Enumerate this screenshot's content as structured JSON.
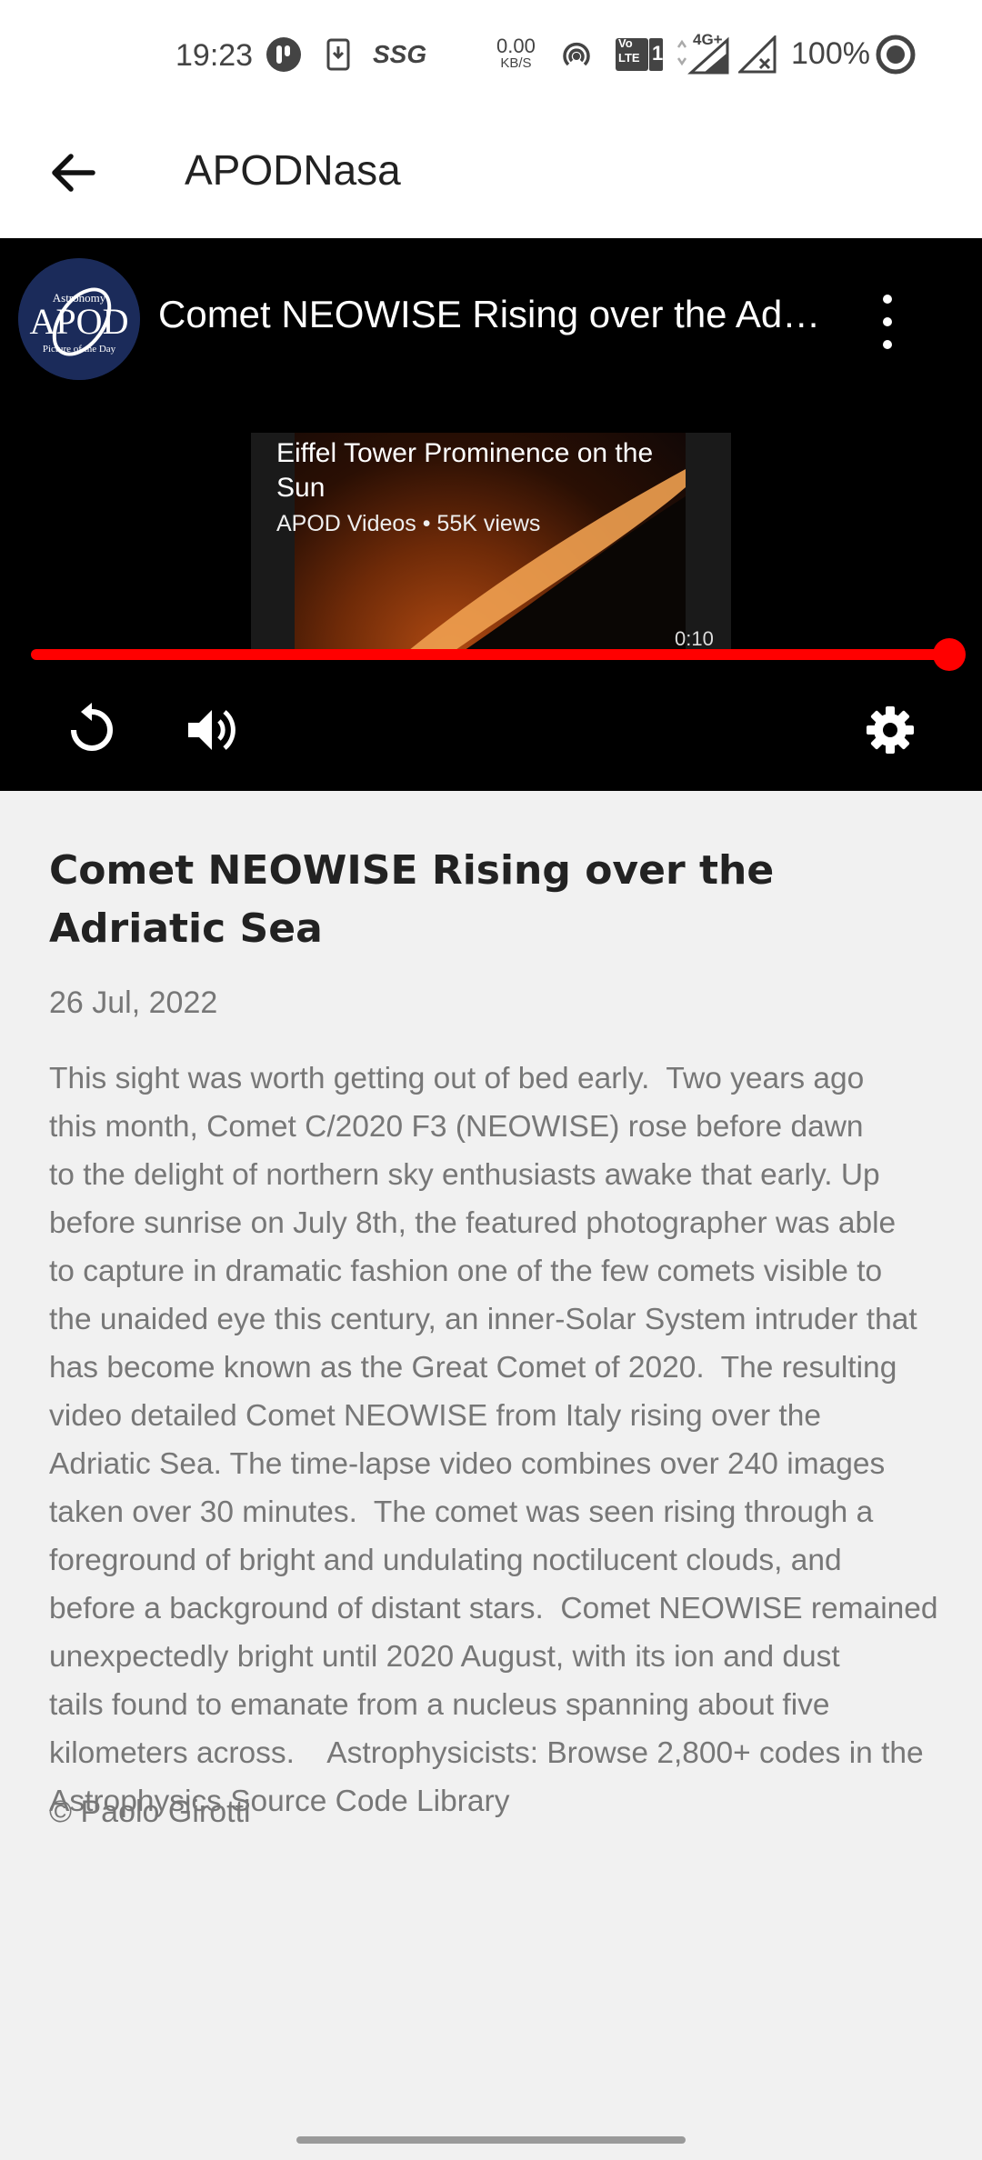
{
  "status_bar": {
    "time": "19:23",
    "net_speed_value": "0.00",
    "net_speed_unit": "KB/S",
    "volte_label": "Vo LTE",
    "volte_sim": "1",
    "network_type": "4G+",
    "battery": "100%",
    "icons": [
      "badge-icon",
      "download-icon",
      "ssg-icon",
      "hotspot-icon",
      "volte-icon",
      "signal-icon",
      "no-signal-icon",
      "battery-ring-icon"
    ]
  },
  "app_bar": {
    "back_icon": "arrow-left-icon",
    "title": "APODNasa"
  },
  "player": {
    "channel_logo_text": "APOD",
    "channel_logo_top": "Astronomy",
    "channel_logo_bottom": "Picture of the Day",
    "video_title": "Comet NEOWISE Rising over the Adriatic Sea",
    "endcard": {
      "title": "Eiffel Tower Prominence on the Sun",
      "meta": "APOD Videos • 55K views",
      "duration": "0:10"
    },
    "progress": 1.0,
    "accent_color": "#ff0000",
    "controls": [
      "replay-icon",
      "volume-icon",
      "settings-icon",
      "more-vert-icon"
    ]
  },
  "article": {
    "title": "Comet NEOWISE Rising over the Adriatic Sea",
    "date": "26 Jul, 2022",
    "body": "This sight was worth getting out of bed early.  Two years ago\nthis month, Comet C/2020 F3 (NEOWISE) rose before dawn\nto the delight of northern sky enthusiasts awake that early. Up\nbefore sunrise on July 8th, the featured photographer was able\nto capture in dramatic fashion one of the few comets visible to\nthe unaided eye this century, an inner-Solar System intruder that\nhas become known as the Great Comet of 2020.  The resulting\nvideo detailed Comet NEOWISE from Italy rising over the\nAdriatic Sea. The time-lapse video combines over 240 images\ntaken over 30 minutes.  The comet was seen rising through a\nforeground of bright and undulating noctilucent clouds, and\nbefore a background of distant stars.  Comet NEOWISE remained\nunexpectedly bright until 2020 August, with its ion and dust\ntails found to emanate from a nucleus spanning about five\nkilometers across.    Astrophysicists: Browse 2,800+ codes in the\nAstrophysics Source Code Library",
    "credit": "© Paolo Girotti"
  }
}
